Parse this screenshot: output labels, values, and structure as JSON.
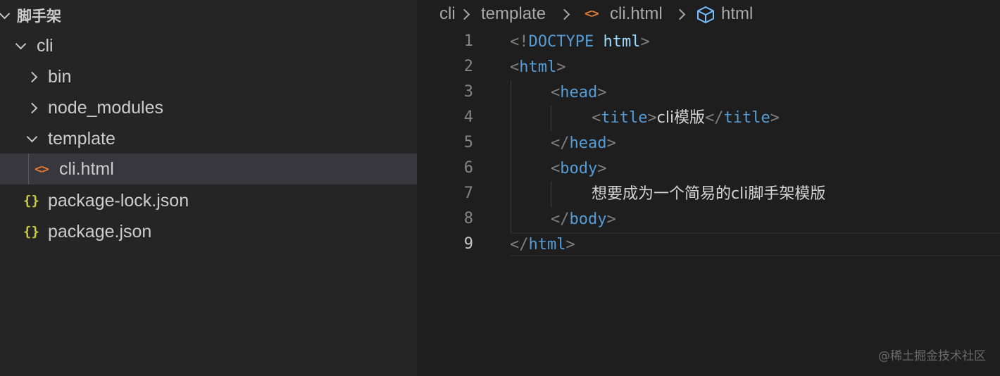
{
  "explorer": {
    "root_label": "脚手架",
    "items": [
      {
        "label": "cli",
        "type": "folder",
        "expanded": true
      },
      {
        "label": "bin",
        "type": "folder",
        "expanded": false
      },
      {
        "label": "node_modules",
        "type": "folder",
        "expanded": false
      },
      {
        "label": "template",
        "type": "folder",
        "expanded": true
      },
      {
        "label": "cli.html",
        "type": "html-file",
        "selected": true
      },
      {
        "label": "package-lock.json",
        "type": "json-file"
      },
      {
        "label": "package.json",
        "type": "json-file"
      }
    ],
    "html_icon_glyph": "<>",
    "json_icon_glyph": "{}"
  },
  "breadcrumb": {
    "items": [
      "cli",
      "template",
      "cli.html",
      "html"
    ],
    "html_icon": "html-file-icon",
    "element_icon": "cube-icon"
  },
  "editor": {
    "line_numbers": [
      "1",
      "2",
      "3",
      "4",
      "5",
      "6",
      "7",
      "8",
      "9"
    ],
    "active_line": "9",
    "code": {
      "l1_open": "<!",
      "l1_doctype": "DOCTYPE",
      "l1_html": "html",
      "l1_close": ">",
      "html_tag": "html",
      "head_tag": "head",
      "title_tag": "title",
      "title_text": "cli模版",
      "body_tag": "body",
      "body_text": "想要成为一个简易的cli脚手架模版",
      "lt": "<",
      "lt_slash": "</",
      "gt": ">"
    }
  },
  "watermark": "@稀土掘金技术社区",
  "colors": {
    "sidebar_bg": "#252526",
    "editor_bg": "#1e1e1e",
    "selected_bg": "#37373d",
    "tag_blue": "#569cd6",
    "html_icon_orange": "#e37933",
    "json_icon_yellow": "#cbcb41"
  }
}
